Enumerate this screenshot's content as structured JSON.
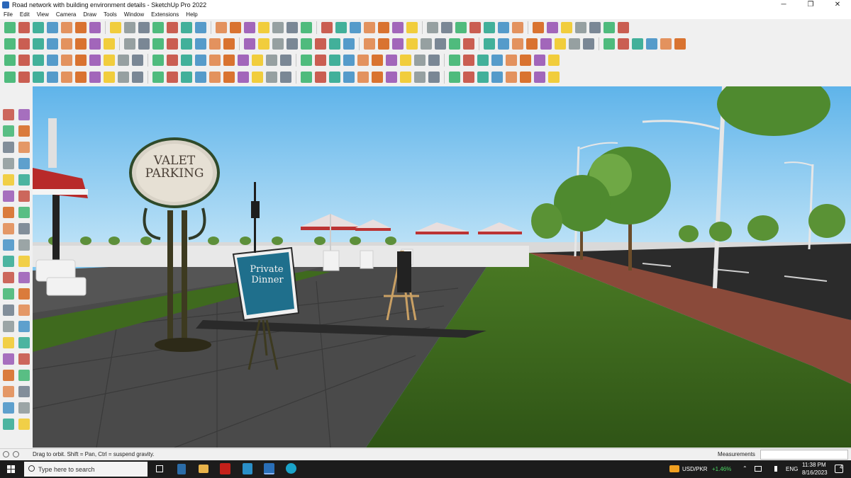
{
  "window": {
    "title": "Road network with building environment details - SketchUp Pro 2022",
    "controls": [
      "─",
      "❐",
      "✕"
    ]
  },
  "menu": [
    "File",
    "Edit",
    "View",
    "Camera",
    "Draw",
    "Tools",
    "Window",
    "Extensions",
    "Help"
  ],
  "scene": {
    "sign_valet_line1": "VALET",
    "sign_valet_line2": "PARKING",
    "sign_private_line1": "Private",
    "sign_private_line2": "Dinner"
  },
  "status": {
    "message": "Drag to orbit. Shift = Pan, Ctrl = suspend gravity.",
    "measurements_label": "Measurements",
    "measurements_value": ""
  },
  "taskbar": {
    "search_placeholder": "Type here to search",
    "currency": "USD/PKR",
    "currency_change": "+1.46%",
    "language": "ENG",
    "time": "11:38 PM",
    "date": "8/16/2023",
    "notification_count": "4"
  },
  "colors": {
    "sky": "#7ec6f0",
    "grass": "#3f6a1e",
    "pavement": "#4a4a4a",
    "brick": "#8a4a3a",
    "sign_blue": "#1f6f8c",
    "currency_up": "#4cd964"
  }
}
